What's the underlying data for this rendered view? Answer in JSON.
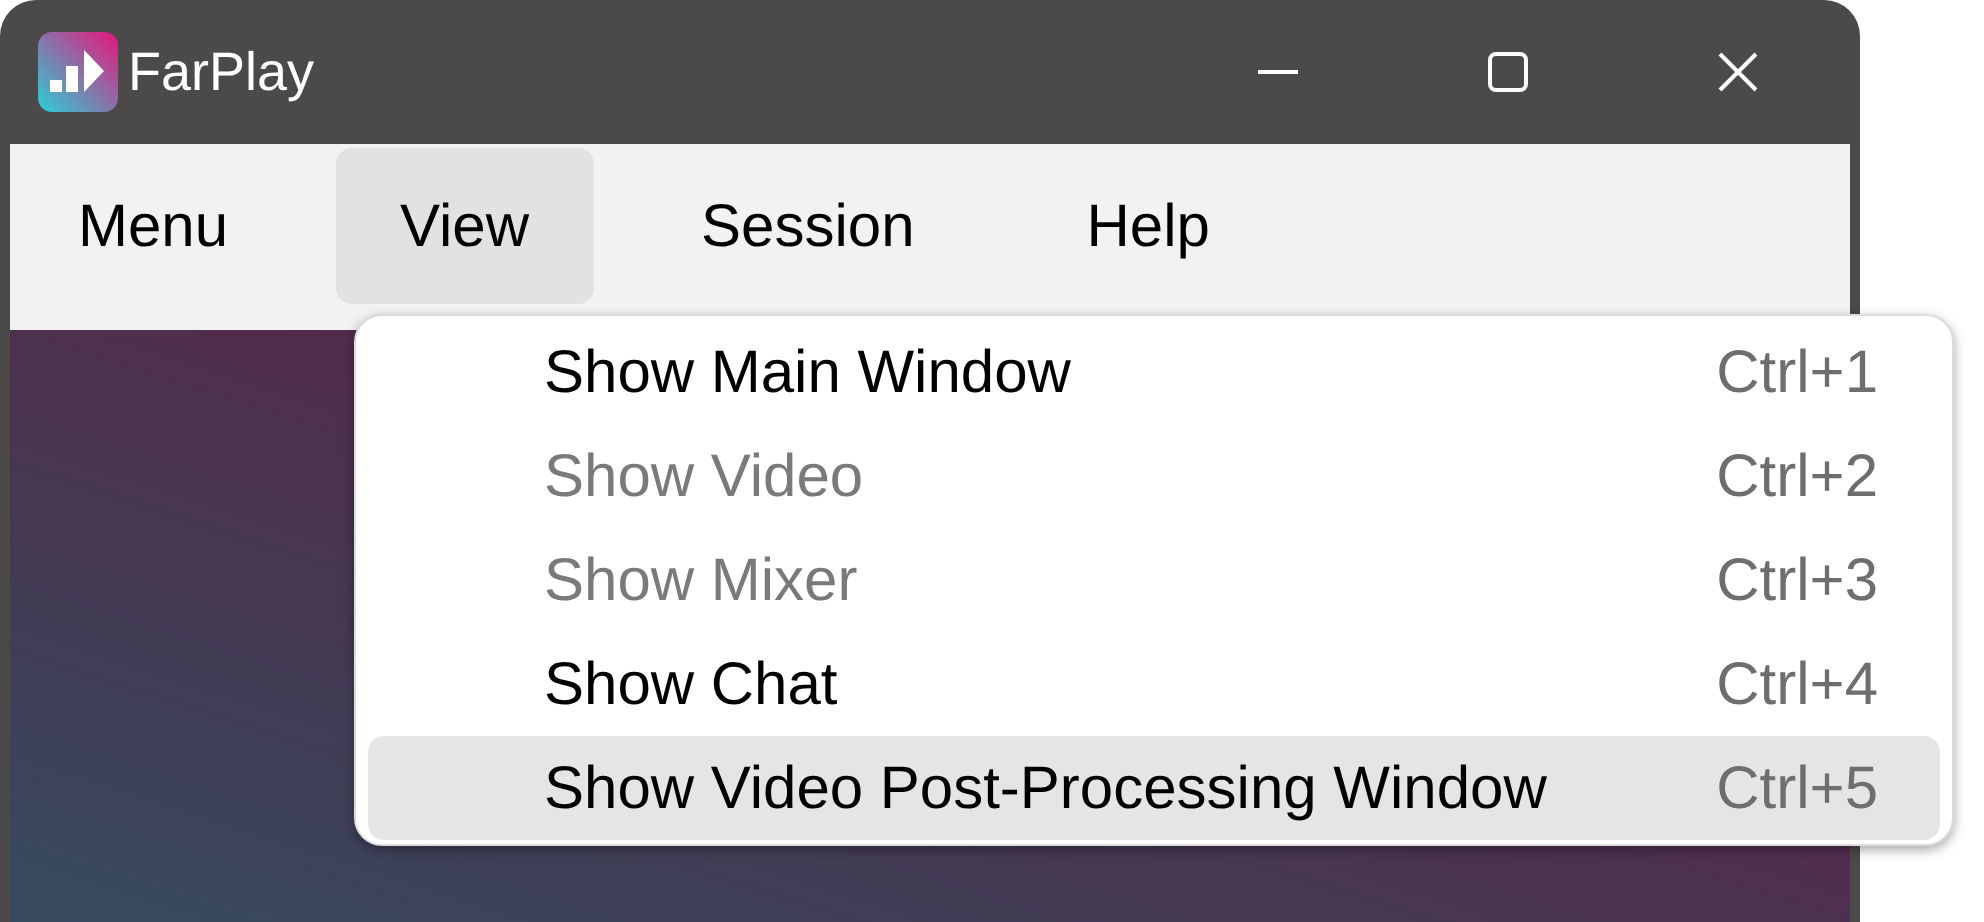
{
  "window": {
    "title": "FarPlay"
  },
  "menu_bar": [
    {
      "label": "Menu",
      "selected": false
    },
    {
      "label": "View",
      "selected": true
    },
    {
      "label": "Session",
      "selected": false
    },
    {
      "label": "Help",
      "selected": false
    }
  ],
  "dropdown": [
    {
      "label": "Show Main Window",
      "shortcut": "Ctrl+1",
      "disabled": false,
      "selected": false
    },
    {
      "label": "Show Video",
      "shortcut": "Ctrl+2",
      "disabled": true,
      "selected": false
    },
    {
      "label": "Show Mixer",
      "shortcut": "Ctrl+3",
      "disabled": true,
      "selected": false
    },
    {
      "label": "Show Chat",
      "shortcut": "Ctrl+4",
      "disabled": false,
      "selected": false
    },
    {
      "label": "Show Video Post-Processing Window",
      "shortcut": "Ctrl+5",
      "disabled": false,
      "selected": true
    }
  ]
}
